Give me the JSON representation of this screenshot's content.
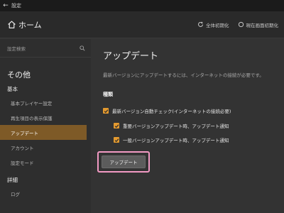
{
  "window": {
    "title": "設定"
  },
  "header": {
    "home_label": "ホーム",
    "reset_all_label": "全体初期化",
    "reset_screen_label": "現在画面初期化"
  },
  "sidebar": {
    "search_placeholder": "設定検索",
    "title": "その他",
    "sections": [
      {
        "label": "基本",
        "items": [
          {
            "label": "基本プレイヤー設定"
          },
          {
            "label": "再生項目の表示保護"
          },
          {
            "label": "アップデート"
          },
          {
            "label": "アカウント"
          },
          {
            "label": "設定モード"
          }
        ]
      },
      {
        "label": "詳細",
        "items": [
          {
            "label": "ログ"
          }
        ]
      }
    ],
    "active_item": "アップデート"
  },
  "main": {
    "title": "アップデート",
    "description": "最新バージョンにアップデートするには、インターネットの接続が必要です。",
    "section_label": "種類",
    "options": [
      {
        "label": "最新バージョン自動チェック(インターネットの接続必要)",
        "checked": true
      },
      {
        "label": "重要バージョンアップデート時、アップデート通知",
        "checked": true
      },
      {
        "label": "一般バージョンアップデート時、アップデート通知",
        "checked": true
      }
    ],
    "update_button_label": "アップデート"
  },
  "colors": {
    "accent": "#e49a2f",
    "active_item_bg": "#7e5a27",
    "highlight_border": "#f29ac4"
  }
}
